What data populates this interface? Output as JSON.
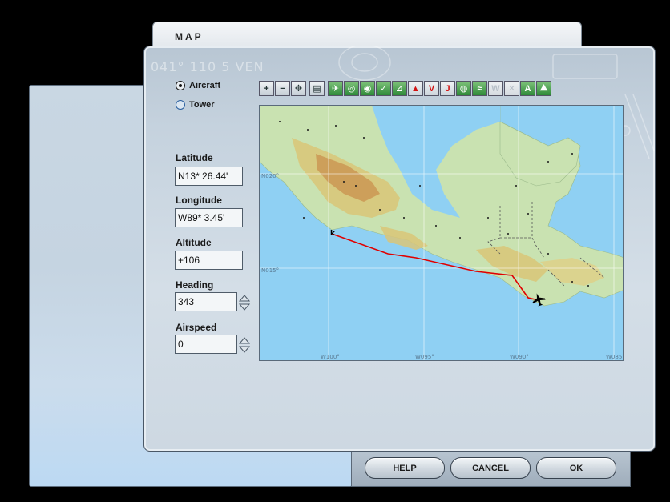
{
  "window": {
    "title": "MAP"
  },
  "decor": {
    "left": "041° 110 5 VEN"
  },
  "view_mode": {
    "options": [
      {
        "label": "Aircraft",
        "selected": true
      },
      {
        "label": "Tower",
        "selected": false
      }
    ]
  },
  "fields": {
    "latitude": {
      "label": "Latitude",
      "value": "N13* 26.44'"
    },
    "longitude": {
      "label": "Longitude",
      "value": "W89* 3.45'"
    },
    "altitude": {
      "label": "Altitude",
      "value": "+106"
    },
    "heading": {
      "label": "Heading",
      "value": "343"
    },
    "airspeed": {
      "label": "Airspeed",
      "value": "0"
    }
  },
  "toolbar": {
    "buttons": [
      {
        "icon": "zoom-in-icon",
        "style": "grey",
        "glyph": "+"
      },
      {
        "icon": "zoom-out-icon",
        "style": "grey",
        "glyph": "−"
      },
      {
        "icon": "center-aircraft-icon",
        "style": "grey",
        "glyph": "✥"
      },
      {
        "icon": "page-icon",
        "style": "grey",
        "glyph": "▤"
      },
      {
        "icon": "airport-icon",
        "style": "green",
        "glyph": "✈"
      },
      {
        "icon": "vor-icon",
        "style": "green",
        "glyph": "◎"
      },
      {
        "icon": "ndb-icon",
        "style": "green",
        "glyph": "◉"
      },
      {
        "icon": "ils-icon",
        "style": "green",
        "glyph": "✓"
      },
      {
        "icon": "airway-icon",
        "style": "green",
        "glyph": "⊿"
      },
      {
        "icon": "triangle-marker-icon",
        "style": "red",
        "glyph": "▲"
      },
      {
        "icon": "victor-airway-icon",
        "style": "red",
        "glyph": "V"
      },
      {
        "icon": "jet-airway-icon",
        "style": "red",
        "glyph": "J"
      },
      {
        "icon": "gps-icon",
        "style": "green",
        "glyph": "◍"
      },
      {
        "icon": "route-icon",
        "style": "green",
        "glyph": "≈"
      },
      {
        "icon": "weather-icon",
        "style": "disabled",
        "glyph": "W"
      },
      {
        "icon": "wind-icon",
        "style": "disabled",
        "glyph": "✕"
      },
      {
        "icon": "text-labels-icon",
        "style": "green",
        "glyph": "A"
      },
      {
        "icon": "terrain-icon",
        "style": "green",
        "glyph": "⛰"
      }
    ]
  },
  "map": {
    "lat_labels": [
      "N020°",
      "N015°"
    ],
    "lon_labels": [
      "W100°",
      "W095°",
      "W090°",
      "W085"
    ]
  },
  "buttons": {
    "help": "HELP",
    "cancel": "CANCEL",
    "ok": "OK"
  },
  "colors": {
    "water": "#8fd0f3",
    "route": "#e10000",
    "land_low": "#c9e2b1"
  }
}
